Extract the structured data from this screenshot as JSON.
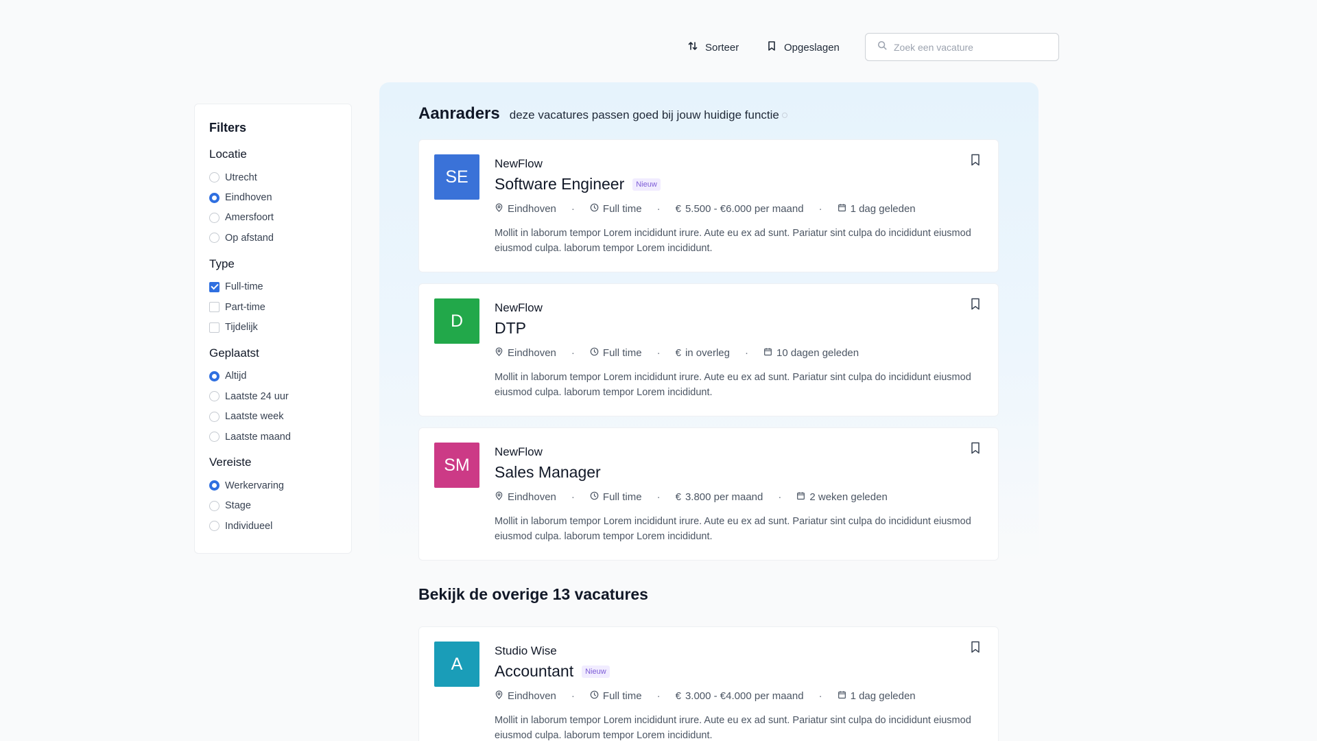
{
  "toolbar": {
    "sort_label": "Sorteer",
    "saved_label": "Opgeslagen",
    "search_placeholder": "Zoek een vacature",
    "search_value": ""
  },
  "filters": {
    "title": "Filters",
    "groups": [
      {
        "title": "Locatie",
        "kind": "radio",
        "options": [
          {
            "label": "Utrecht",
            "selected": false
          },
          {
            "label": "Eindhoven",
            "selected": true
          },
          {
            "label": "Amersfoort",
            "selected": false
          },
          {
            "label": "Op afstand",
            "selected": false
          }
        ]
      },
      {
        "title": "Type",
        "kind": "checkbox",
        "options": [
          {
            "label": "Full-time",
            "selected": true
          },
          {
            "label": "Part-time",
            "selected": false
          },
          {
            "label": "Tijdelijk",
            "selected": false
          }
        ]
      },
      {
        "title": "Geplaatst",
        "kind": "radio",
        "options": [
          {
            "label": "Altijd",
            "selected": true
          },
          {
            "label": "Laatste 24 uur",
            "selected": false
          },
          {
            "label": "Laatste week",
            "selected": false
          },
          {
            "label": "Laatste maand",
            "selected": false
          }
        ]
      },
      {
        "title": "Vereiste",
        "kind": "radio",
        "options": [
          {
            "label": "Werkervaring",
            "selected": true
          },
          {
            "label": "Stage",
            "selected": false
          },
          {
            "label": "Individueel",
            "selected": false
          }
        ]
      }
    ]
  },
  "recommended": {
    "title": "Aanraders",
    "subtitle": "deze vacatures passen goed bij jouw huidige functie"
  },
  "other": {
    "title": "Bekijk de overige 13 vacatures"
  },
  "colors": {
    "accent": "#2f6fe0",
    "logo_blue": "#3a72d8",
    "logo_green": "#22a84a",
    "logo_pink": "#cc3a86",
    "logo_teal": "#1a9db8"
  },
  "jobs": [
    {
      "initials": "SE",
      "logo_color": "#3a72d8",
      "company": "NewFlow",
      "title": "Software Engineer",
      "badge": "Nieuw",
      "location": "Eindhoven",
      "hours": "Full time",
      "salary": "5.500 - €6.000 per maand",
      "posted": "1 dag geleden",
      "description": "Mollit in laborum tempor Lorem incididunt irure. Aute eu ex ad sunt. Pariatur sint culpa do incididunt eiusmod eiusmod culpa. laborum tempor Lorem incididunt."
    },
    {
      "initials": "D",
      "logo_color": "#22a84a",
      "company": "NewFlow",
      "title": "DTP",
      "badge": "",
      "location": "Eindhoven",
      "hours": "Full time",
      "salary": "in overleg",
      "posted": "10 dagen geleden",
      "description": "Mollit in laborum tempor Lorem incididunt irure. Aute eu ex ad sunt. Pariatur sint culpa do incididunt eiusmod eiusmod culpa. laborum tempor Lorem incididunt."
    },
    {
      "initials": "SM",
      "logo_color": "#cc3a86",
      "company": "NewFlow",
      "title": "Sales Manager",
      "badge": "",
      "location": "Eindhoven",
      "hours": "Full time",
      "salary": "3.800 per maand",
      "posted": "2 weken geleden",
      "description": "Mollit in laborum tempor Lorem incididunt irure. Aute eu ex ad sunt. Pariatur sint culpa do incididunt eiusmod eiusmod culpa. laborum tempor Lorem incididunt."
    },
    {
      "initials": "A",
      "logo_color": "#1a9db8",
      "company": "Studio Wise",
      "title": "Accountant",
      "badge": "Nieuw",
      "location": "Eindhoven",
      "hours": "Full time",
      "salary": "3.000 - €4.000 per maand",
      "posted": "1 dag geleden",
      "description": "Mollit in laborum tempor Lorem incididunt irure. Aute eu ex ad sunt. Pariatur sint culpa do incididunt eiusmod eiusmod culpa. laborum tempor Lorem incididunt."
    }
  ]
}
